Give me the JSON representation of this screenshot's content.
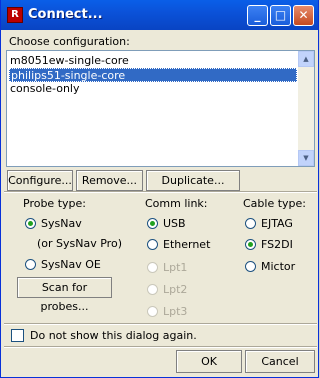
{
  "window": {
    "title": "Connect...",
    "app_icon_text": "R",
    "controls": {
      "minimize": "_",
      "maximize": "□",
      "close": "✕"
    }
  },
  "config": {
    "label": "Choose configuration:",
    "items": [
      {
        "label": "m8051ew-single-core",
        "selected": false
      },
      {
        "label": "philips51-single-core",
        "selected": true
      },
      {
        "label": "console-only",
        "selected": false
      }
    ],
    "scroll_up_glyph": "▲",
    "scroll_down_glyph": "▼"
  },
  "config_buttons": {
    "configure": "Configure...",
    "remove": "Remove...",
    "duplicate": "Duplicate..."
  },
  "probe": {
    "label": "Probe type:",
    "options": [
      {
        "label": "SysNav",
        "selected": true
      },
      {
        "label": "SysNav OE",
        "selected": false
      }
    ],
    "note": "(or SysNav Pro)",
    "scan_button": "Scan for probes..."
  },
  "comm": {
    "label": "Comm link:",
    "options": [
      {
        "label": "USB",
        "selected": true,
        "enabled": true
      },
      {
        "label": "Ethernet",
        "selected": false,
        "enabled": true
      },
      {
        "label": "Lpt1",
        "selected": false,
        "enabled": false
      },
      {
        "label": "Lpt2",
        "selected": false,
        "enabled": false
      },
      {
        "label": "Lpt3",
        "selected": false,
        "enabled": false
      }
    ]
  },
  "cable": {
    "label": "Cable type:",
    "options": [
      {
        "label": "EJTAG",
        "selected": false
      },
      {
        "label": "FS2DI",
        "selected": true
      },
      {
        "label": "Mictor",
        "selected": false
      }
    ]
  },
  "footer": {
    "checkbox_label": "Do not show this dialog again.",
    "checkbox_checked": false,
    "ok": "OK",
    "cancel": "Cancel"
  },
  "colors": {
    "title_bar": "#0a5fe8",
    "selection": "#316ac5",
    "radio_dot": "#21a121",
    "dialog_bg": "#ece9d8"
  }
}
